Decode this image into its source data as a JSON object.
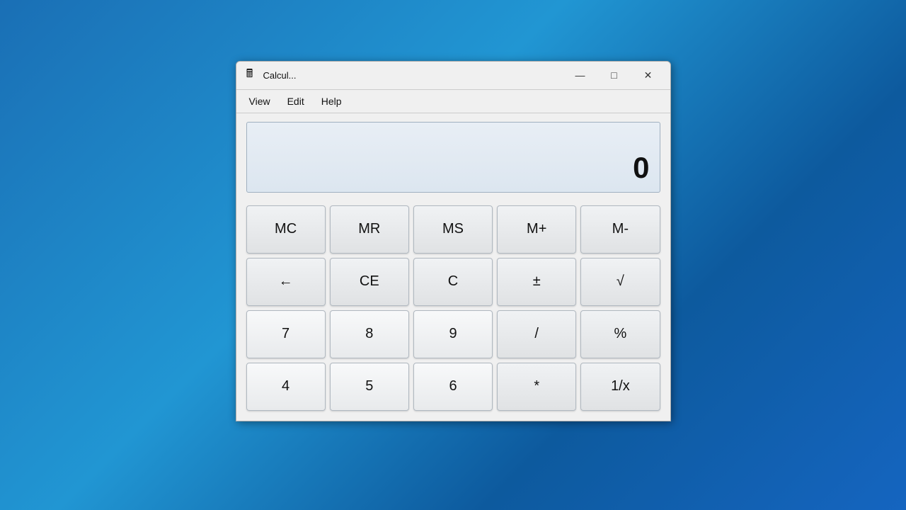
{
  "window": {
    "title": "Calcul...",
    "icon": "🖩"
  },
  "titlebar": {
    "minimize_label": "—",
    "maximize_label": "□",
    "close_label": "✕"
  },
  "menu": {
    "items": [
      "View",
      "Edit",
      "Help"
    ]
  },
  "display": {
    "value": "0"
  },
  "buttons": {
    "memory_row": [
      "MC",
      "MR",
      "MS",
      "M+",
      "M-"
    ],
    "control_row": [
      "←",
      "CE",
      "C",
      "±",
      "√"
    ],
    "row1": [
      "7",
      "8",
      "9",
      "/",
      "%"
    ],
    "row2": [
      "4",
      "5",
      "6",
      "*",
      "1/x"
    ]
  }
}
